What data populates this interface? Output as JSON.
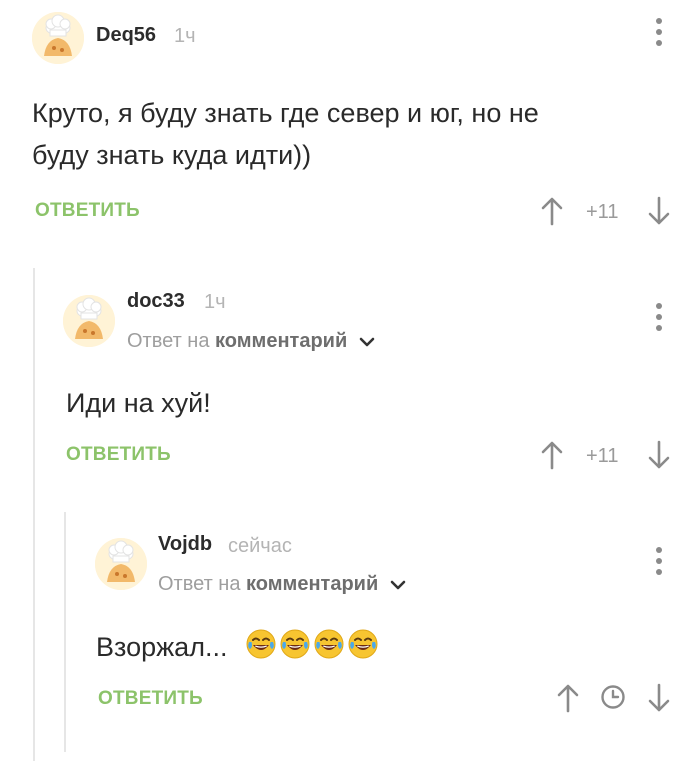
{
  "comments": [
    {
      "author": "Deq56",
      "time": "1ч",
      "text_line1": "Круто, я буду знать где север и юг, но не",
      "text_line2": "буду знать куда идти))",
      "reply_label": "ОТВЕТИТЬ",
      "rating": "+11"
    },
    {
      "author": "doc33",
      "time": "1ч",
      "reply_to_prefix": "Ответ на",
      "reply_to_target": "комментарий",
      "text": "Иди на хуй!",
      "reply_label": "ОТВЕТИТЬ",
      "rating": "+11"
    },
    {
      "author": "Vojdb",
      "time": "сейчас",
      "reply_to_prefix": "Ответ на",
      "reply_to_target": "комментарий",
      "text": "Взоржал...",
      "emojis": [
        "tears-of-joy-emoji",
        "tears-of-joy-emoji",
        "tears-of-joy-emoji",
        "tears-of-joy-emoji"
      ],
      "reply_label": "ОТВЕТИТЬ"
    }
  ],
  "icons": {
    "avatar": "default-chef-avatar-icon",
    "more": "more-vertical-icon",
    "upvote": "arrow-up-icon",
    "downvote": "arrow-down-icon",
    "pending": "clock-icon",
    "expand": "chevron-down-icon"
  },
  "colors": {
    "reply_button": "#8cc36a",
    "thread_line": "#e6e6e6",
    "muted_text": "#9e9e9e"
  }
}
